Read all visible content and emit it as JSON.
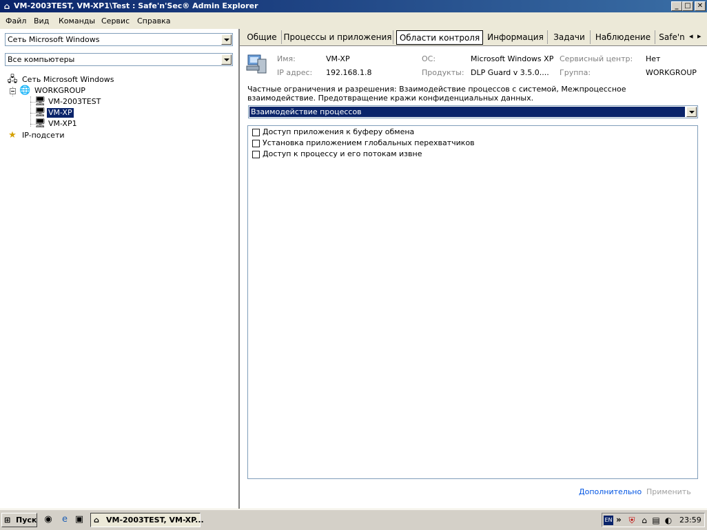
{
  "window": {
    "title": "VM-2003TEST, VM-XP1\\Test : Safe'n'Sec® Admin Explorer",
    "app_icon": "network-icon"
  },
  "window_buttons": {
    "minimize": "_",
    "maximize": "□",
    "close": "✕"
  },
  "menu": {
    "items": [
      "Файл",
      "Вид",
      "Команды",
      "Сервис",
      "Справка"
    ]
  },
  "left": {
    "network_combo": "Сеть Microsoft Windows",
    "computers_combo": "Все компьютеры",
    "tree": {
      "root": "Сеть Microsoft Windows",
      "workgroup": "WORKGROUP",
      "computers": [
        "VM-2003TEST",
        "VM-XP",
        "VM-XP1"
      ],
      "selected": "VM-XP",
      "subnets": "IP-подсети"
    }
  },
  "tabs": {
    "items": [
      "Общие",
      "Процессы и приложения",
      "Области контроля",
      "Информация",
      "Задачи",
      "Наблюдение",
      "Safe'n"
    ],
    "active": "Области контроля"
  },
  "info": {
    "name_label": "Имя:",
    "name_value": "VM-XP",
    "ip_label": "IP адрес:",
    "ip_value": "192.168.1.8",
    "os_label": "ОС:",
    "os_value": "Microsoft Windows XP",
    "products_label": "Продукты:",
    "products_value": "DLP Guard v 3.5.0....",
    "service_label": "Сервисный центр:",
    "service_value": "Нет",
    "group_label": "Группа:",
    "group_value": "WORKGROUP"
  },
  "description": "Частные ограничения и разрешения: Взаимодействие процессов с системой, Межпроцессное взаимодействие. Предотвращение кражи конфиденциальных данных.",
  "category_select": {
    "value": "Взаимодействие процессов"
  },
  "checklist": [
    {
      "label": "Доступ приложения к буферу обмена",
      "checked": false
    },
    {
      "label": "Установка приложением глобальных перехватчиков",
      "checked": false
    },
    {
      "label": "Доступ к процессу и его потокам извне",
      "checked": false
    }
  ],
  "actions": {
    "more": "Дополнительно",
    "apply": "Применить"
  },
  "taskbar": {
    "start": "Пуск",
    "task_button": "VM-2003TEST, VM-XP...",
    "lang": "EN",
    "clock": "23:59"
  },
  "colors": {
    "selection": "#0a246a",
    "link": "#0054e3",
    "disabled": "#a0a0a0"
  }
}
